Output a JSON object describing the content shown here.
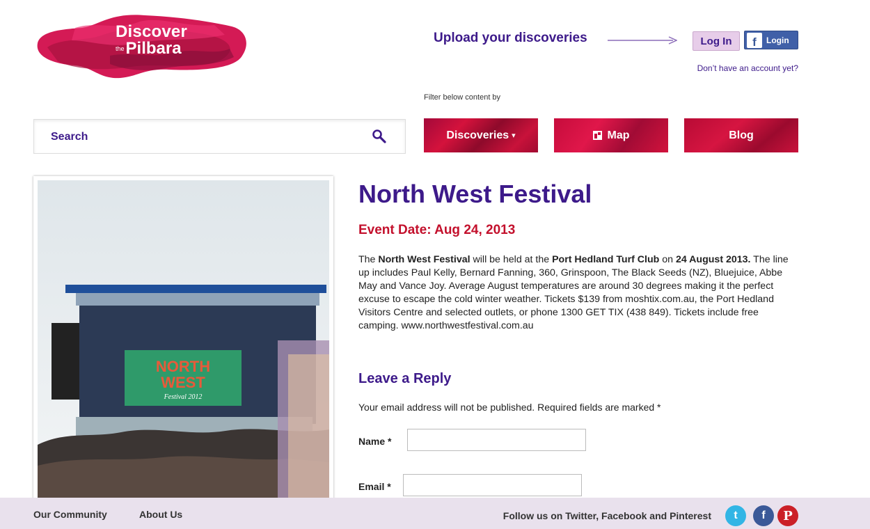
{
  "logo": {
    "line1": "Discover",
    "the": "the",
    "line2": "Pilbara"
  },
  "header": {
    "upload_text": "Upload your discoveries",
    "login_label": "Log In",
    "fb_login_label": "Login",
    "fb_icon_glyph": "f",
    "no_account_text": "Don’t have an account yet?",
    "filter_label": "Filter below content by"
  },
  "search": {
    "placeholder": "Search"
  },
  "nav": {
    "discoveries": "Discoveries",
    "discoveries_caret": "▾",
    "map": "Map",
    "blog": "Blog"
  },
  "article": {
    "title": "North West Festival",
    "event_date": "Event Date: Aug 24, 2013",
    "body": {
      "p1": "The ",
      "b1": "North West Festival",
      "p2": " will be held at the ",
      "b2": "Port Hedland Turf Club",
      "p3": " on ",
      "b3": "24 August 2013.",
      "p4": " The line up includes Paul Kelly, Bernard Fanning, 360, Grinspoon, The Black Seeds (NZ), Bluejuice, Abbe May and Vance Joy. Average August temperatures are around 30 degrees making it the perfect excuse to escape the cold winter weather. Tickets $139 from moshtix.com.au, the Port Hedland Visitors Centre and selected outlets, or phone 1300 GET TIX (438 849). Tickets include free camping. www.northwestfestival.com.au"
    },
    "photo_screen": {
      "line1": "NORTH",
      "line2": "WEST",
      "line3": "Festival 2012"
    }
  },
  "reply": {
    "title": "Leave a Reply",
    "note": "Your email address will not be published. Required fields are marked *",
    "name_label": "Name *",
    "email_label": "Email *"
  },
  "footer": {
    "community": "Our Community",
    "about": "About Us",
    "follow": "Follow us on Twitter, Facebook and Pinterest",
    "twitter_glyph": "t",
    "facebook_glyph": "f",
    "pinterest_glyph": "P"
  },
  "colors": {
    "brand_purple": "#3d1a8a",
    "event_red": "#c3102c",
    "nav_red": "#c8123a",
    "footer_bg": "#e9e1ed",
    "facebook_blue": "#3b5998",
    "twitter_blue": "#32b5e5",
    "pinterest_red": "#cb2027"
  },
  "icons": {
    "search": "search-icon",
    "map": "map-icon",
    "arrow": "arrow-right-icon",
    "facebook": "facebook-icon",
    "twitter": "twitter-icon",
    "pinterest": "pinterest-icon"
  }
}
